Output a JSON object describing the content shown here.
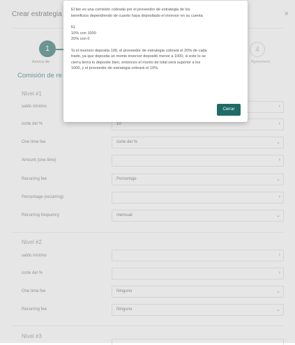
{
  "header": {
    "title": "Crear estrategia",
    "close_symbol": "×"
  },
  "stepper": {
    "step1_number": "1",
    "step1_label": "Acerca de",
    "step4_number": "4",
    "step4_label": "Agreement"
  },
  "main": {
    "section_title": "Comisión de re",
    "level1": {
      "title": "Nivel #1",
      "rows": [
        {
          "label": "saldo mínimo",
          "value": ""
        },
        {
          "label": "corte del %",
          "value": "10"
        },
        {
          "label": "One time fee",
          "value": "corte del %"
        },
        {
          "label": "Amount (one-time)",
          "value": ""
        },
        {
          "label": "Recurring fee",
          "value": "Porcentaje"
        },
        {
          "label": "Percentage (recurring)",
          "value": ""
        },
        {
          "label": "Recurring frequency",
          "value": "mensual"
        }
      ]
    },
    "level2": {
      "title": "Nivel #2",
      "rows": [
        {
          "label": "saldo mínimo",
          "value": ""
        },
        {
          "label": "corte del %",
          "value": ""
        },
        {
          "label": "One time fee",
          "value": "Ninguno"
        },
        {
          "label": "Recurring fee",
          "value": "Ninguno"
        }
      ]
    },
    "level3": {
      "title": "Nivel #3"
    }
  },
  "popup": {
    "line1": "El tier es una comisión cobrada por el proveedor de estrategia de los",
    "line2": "beneficios dependiendo de cuanto haya depositado el inversor en su cuenta",
    "ex_label": "Ej.",
    "ex_1": "10% con 1000",
    "ex_2": "20% con 0",
    "p2_1": "Si el inversor deposita 100, el proveedor de estrategia cobrará el 20% de cada",
    "p2_2": "trade, ya que deposita un monto inversor depositó menor a 1000, si este lo se",
    "p2_3": "cierra tierra lo deposite bien, entonces el monto de total será superior a los",
    "p2_4": "1000, y el proveedor de estrategia cobrará el 10%.",
    "close_label": "Cerrar"
  },
  "colors": {
    "accent": "#1f6b66",
    "title_dot": "#f0b429"
  }
}
